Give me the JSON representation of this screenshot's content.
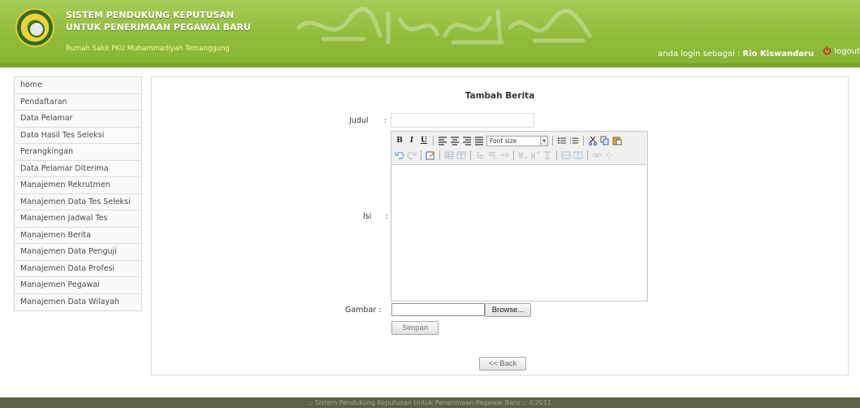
{
  "header": {
    "title_line1": "SISTEM PENDUKUNG KEPUTUSAN",
    "title_line2": "UNTUK PENERIMAAN PEGAWAI BARU",
    "subtitle": "Rumah Sakit PKU Muhammadiyah Temanggung",
    "login_prefix": "anda login sebagai :",
    "username": "Rio Kiswandaru",
    "logout_label": "logout",
    "colors": {
      "header_green": "#8fbc3a",
      "subtitle_yellow": "#fff59d",
      "footer": "#5e6248"
    }
  },
  "sidebar": {
    "items": [
      {
        "label": "home"
      },
      {
        "label": "Pendaftaran"
      },
      {
        "label": "Data Pelamar"
      },
      {
        "label": "Data Hasil Tes Seleksi"
      },
      {
        "label": "Perangkingan"
      },
      {
        "label": "Data Pelamar Diterima"
      },
      {
        "label": "Manajemen Rekrutmen"
      },
      {
        "label": "Manajemen Data Tes Seleksi"
      },
      {
        "label": "Manajemen Jadwal Tes"
      },
      {
        "label": "Manajemen Berita"
      },
      {
        "label": "Manajemen Data Penguji"
      },
      {
        "label": "Manajemen Data Profesi"
      },
      {
        "label": "Manajemen Pegawai"
      },
      {
        "label": "Manajemen Data Wilayah"
      }
    ]
  },
  "form": {
    "title": "Tambah Berita",
    "judul_label": "Judul",
    "isi_label": "Isi",
    "gambar_label": "Gambar :",
    "colon": ":",
    "judul_value": "",
    "editor": {
      "bold": "B",
      "italic": "I",
      "underline": "U",
      "fontsize_label": "Font size"
    },
    "browse_label": "Browse...",
    "simpan_label": "Simpan",
    "back_label": "<< Back"
  },
  "footer": {
    "text": ":: Sistem Pendukung Keputusan Untuk Penerimaan Pegawai Baru ::  ©2011"
  }
}
